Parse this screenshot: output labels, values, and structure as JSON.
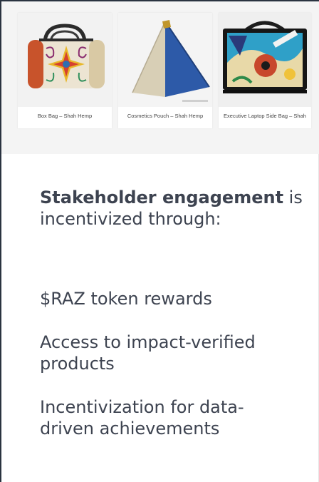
{
  "gallery": {
    "products": [
      {
        "caption": "Box Bag – Shah Hemp"
      },
      {
        "caption": "Cosmetics Pouch – Shah Hemp"
      },
      {
        "caption": "Executive Laptop Side Bag – Shah"
      }
    ]
  },
  "content": {
    "heading_bold": "Stakeholder engagement",
    "heading_rest": " is incentivized through:",
    "bullets": [
      "$RAZ token rewards",
      "Access to impact-verified products",
      "Incentivization for data-driven achievements"
    ]
  },
  "colors": {
    "text": "#3d4350",
    "band_background": "#f4f4f4",
    "frame_border": "#2a3340"
  }
}
